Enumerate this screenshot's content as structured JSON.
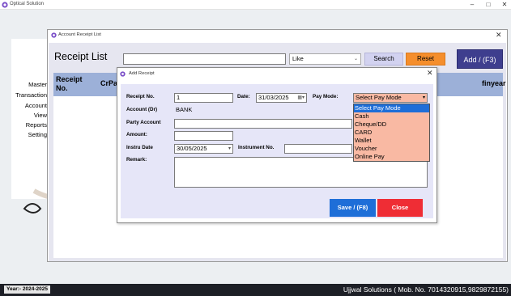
{
  "app": {
    "title": "Optical Solution",
    "minimize_glyph": "–",
    "maximize_glyph": "□",
    "close_glyph": "✕",
    "accent": "#7b4fc8"
  },
  "left_menu": {
    "items": [
      "Master",
      "Transaction",
      "Account",
      "View",
      "Reports",
      "Setting"
    ]
  },
  "status_bar": {
    "year": "Year:- 2024-2025",
    "company": "Ujjwal Solutions ( Mob. No. 7014320915,9829872155)"
  },
  "list_window": {
    "window_title": "Account Receipt List",
    "close_glyph": "✕",
    "page_title": "Receipt List",
    "search_value": "",
    "match_mode": "Like",
    "search_label": "Search",
    "reset_label": "Reset",
    "add_label": "Add / (F3)",
    "columns": [
      "Receipt No.",
      "CrPa",
      "finyear"
    ],
    "rows": []
  },
  "dialog": {
    "title": "Add Receipt",
    "close_glyph": "✕",
    "receipt_no_label": "Receipt No.",
    "receipt_no": "1",
    "date_label": "Date:",
    "date": "31/03/2025",
    "pay_mode_label": "Pay Mode:",
    "pay_mode_selected": "Select Pay Mode",
    "pay_mode_options": [
      "Select Pay Mode",
      "Cash",
      "Cheque/DD",
      "CARD",
      "Wallet",
      "Voucher",
      "Online Pay"
    ],
    "account_label": "Account (Dr)",
    "account": "BANK",
    "party_account_label": "Party Account",
    "party_account": "",
    "amount_label": "Amount:",
    "amount": "",
    "instru_date_label": "Instru Date",
    "instru_date": "30/05/2025",
    "instrument_no_label": "Instrument No.",
    "instrument_no": "",
    "remark_label": "Remark:",
    "remark": "",
    "save_label": "Save / (F8)",
    "close_label": "Close",
    "colors": {
      "save": "#1e6ed8",
      "close": "#ef2d35",
      "dropdown_bg": "#f9b9a3",
      "selected_option": "#1e6ed8"
    }
  }
}
